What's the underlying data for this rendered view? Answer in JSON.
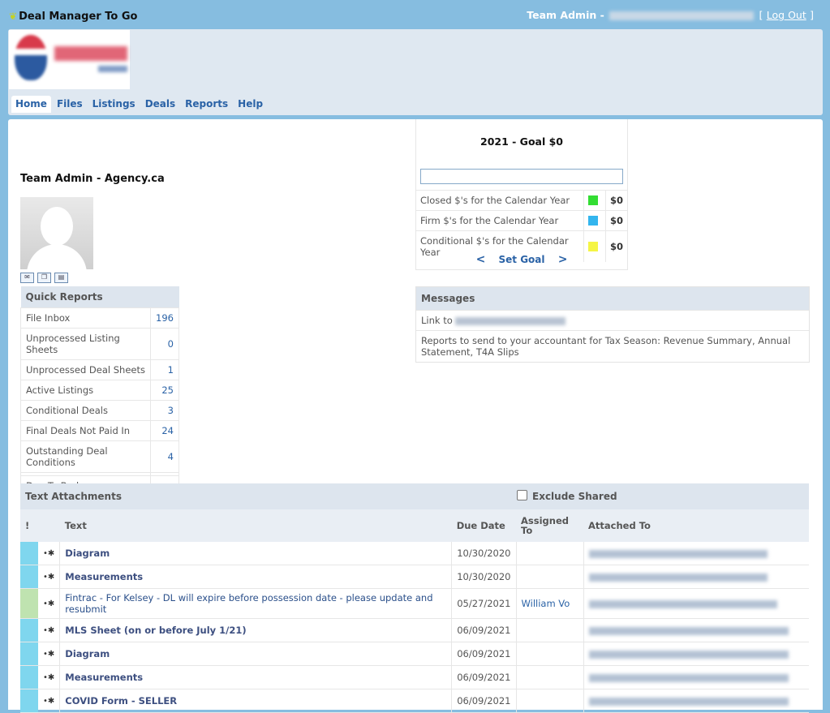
{
  "app": {
    "title": "Deal Manager To Go"
  },
  "user": {
    "label": "Team Admin -",
    "bracket_open": "[",
    "logout": "Log Out",
    "bracket_close": "]"
  },
  "nav": {
    "items": [
      "Home",
      "Files",
      "Listings",
      "Deals",
      "Reports",
      "Help"
    ],
    "active": "Home"
  },
  "agent": {
    "name": "Team Admin - Agency.ca"
  },
  "goal": {
    "title": "2021 - Goal $0",
    "rows": [
      {
        "label": "Closed $'s for the Calendar Year",
        "color": "#33dd33",
        "amount": "$0"
      },
      {
        "label": "Firm $'s for the Calendar Year",
        "color": "#33b5ee",
        "amount": "$0"
      },
      {
        "label": "Conditional $'s for the Calendar Year",
        "color": "#f5f545",
        "amount": "$0"
      }
    ],
    "prev": "<",
    "set_goal": "Set Goal",
    "next": ">"
  },
  "quick_reports": {
    "title": "Quick Reports",
    "rows": [
      {
        "label": "File Inbox",
        "value": "196"
      },
      {
        "label": "Unprocessed Listing Sheets",
        "value": "0"
      },
      {
        "label": "Unprocessed Deal Sheets",
        "value": "1"
      },
      {
        "label": "Active Listings",
        "value": "25"
      },
      {
        "label": "Conditional Deals",
        "value": "3"
      },
      {
        "label": "Final Deals Not Paid In",
        "value": "24"
      },
      {
        "label": "Outstanding Deal Conditions",
        "value": "4"
      }
    ],
    "due": {
      "label": "Due To Brokerage",
      "value": ""
    }
  },
  "messages": {
    "title": "Messages",
    "link_prefix": "Link to",
    "body": "Reports to send to your accountant for Tax Season: Revenue Summary, Annual Statement, T4A Slips"
  },
  "attachments": {
    "title": "Text Attachments",
    "exclude_shared": "Exclude Shared",
    "columns": {
      "flag": "!",
      "text": "Text",
      "due": "Due Date",
      "assigned": "Assigned To",
      "attached": "Attached To"
    },
    "rows": [
      {
        "flag_color": "#7fd6ee",
        "text": "Diagram",
        "bold": true,
        "due": "10/30/2020",
        "assigned": ""
      },
      {
        "flag_color": "#7fd6ee",
        "text": "Measurements",
        "bold": true,
        "due": "10/30/2020",
        "assigned": ""
      },
      {
        "flag_color": "#bfe3b0",
        "text": "Fintrac - For Kelsey - DL will expire before possession date - please update and resubmit",
        "bold": false,
        "due": "05/27/2021",
        "assigned": "William Vo"
      },
      {
        "flag_color": "#7fd6ee",
        "text": "MLS Sheet (on or before July 1/21)",
        "bold": true,
        "due": "06/09/2021",
        "assigned": ""
      },
      {
        "flag_color": "#7fd6ee",
        "text": "Diagram",
        "bold": true,
        "due": "06/09/2021",
        "assigned": ""
      },
      {
        "flag_color": "#7fd6ee",
        "text": "Measurements",
        "bold": true,
        "due": "06/09/2021",
        "assigned": ""
      },
      {
        "flag_color": "#7fd6ee",
        "text": "COVID Form - SELLER",
        "bold": true,
        "due": "06/09/2021",
        "assigned": ""
      }
    ]
  }
}
